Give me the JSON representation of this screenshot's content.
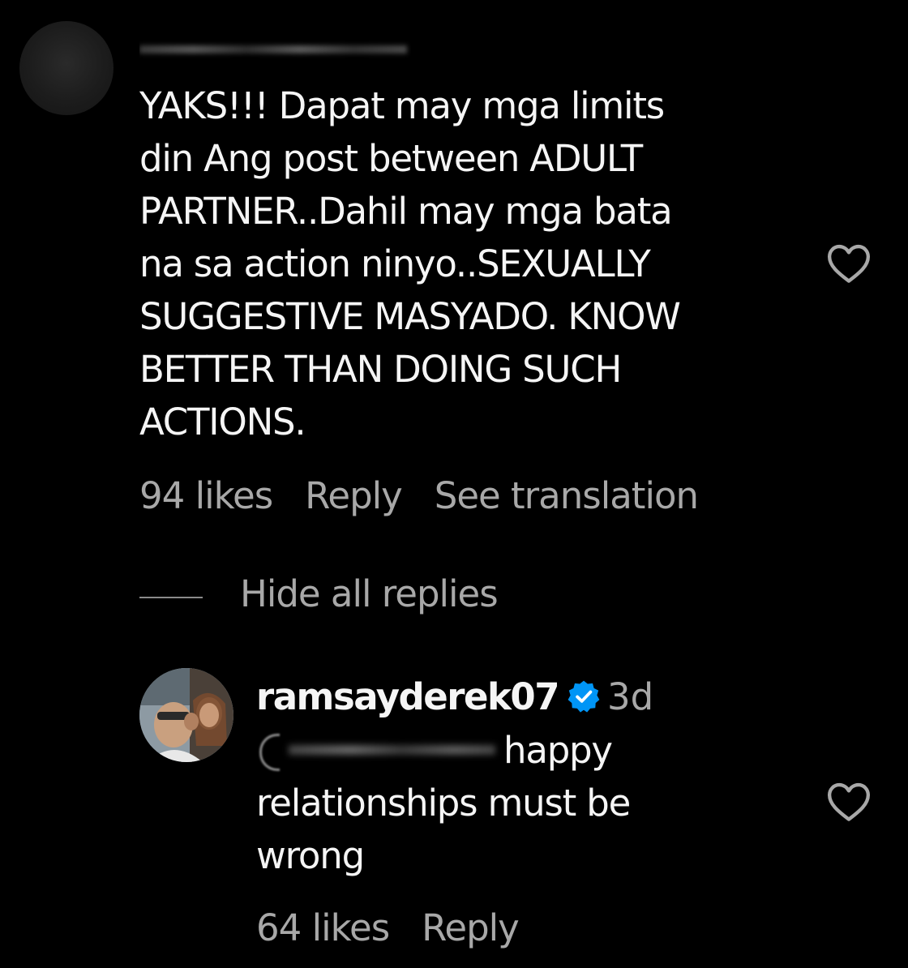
{
  "comment": {
    "text_lines": [
      "YAKS!!! Dapat may mga limits",
      "din Ang post between ADULT",
      "PARTNER..Dahil may mga bata",
      "na sa action ninyo..SEXUALLY",
      "SUGGESTIVE MASYADO. KNOW",
      "BETTER THAN DOING SUCH",
      "ACTIONS."
    ],
    "likes": "94 likes",
    "reply_label": "Reply",
    "translate_label": "See translation",
    "like_icon": "heart-outline-icon"
  },
  "replies_toggle": {
    "label": "Hide all replies"
  },
  "reply": {
    "username": "ramsayderek07",
    "verified_icon": "verified-badge-icon",
    "time": "3d",
    "text_first": "happy",
    "text_lines": [
      "relationships must be",
      "wrong"
    ],
    "likes": "64 likes",
    "reply_label": "Reply",
    "like_icon": "heart-outline-icon"
  },
  "colors": {
    "background": "#000000",
    "text": "#f5f5f5",
    "secondary": "#a8a8a8",
    "verified": "#0095f6"
  }
}
